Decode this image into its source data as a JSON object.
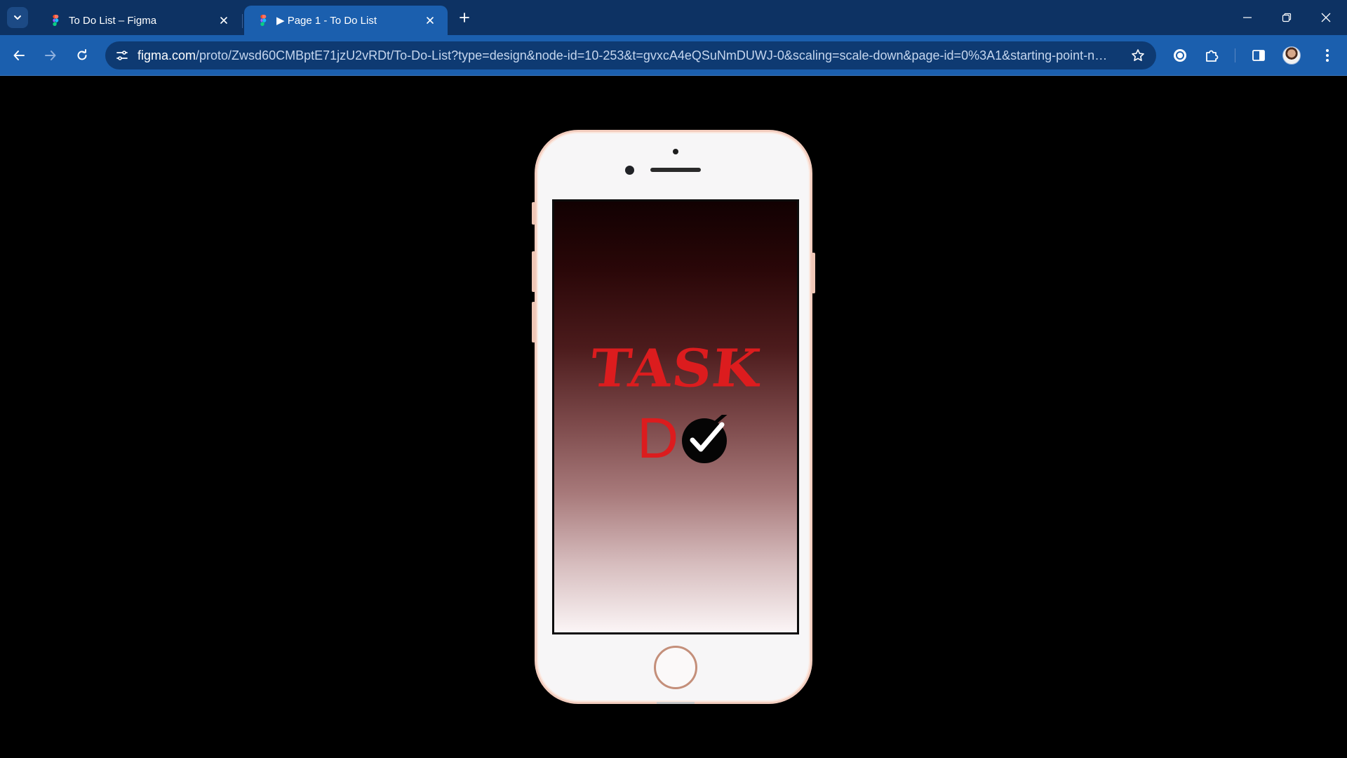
{
  "browser": {
    "tabs": [
      {
        "title": "To Do List – Figma",
        "active": false
      },
      {
        "title": "▶ Page 1 - To Do List",
        "active": true
      }
    ],
    "url_host": "figma.com",
    "url_path": "/proto/Zwsd60CMBptE71jzU2vRDt/To-Do-List?type=design&node-id=10-253&t=gvxcA4eQSuNmDUWJ-0&scaling=scale-down&page-id=0%3A1&starting-point-node-i...",
    "colors": {
      "tabstrip": "#0d3263",
      "toolbar": "#1b5fae",
      "omnibox": "#0e3a72"
    },
    "icons": {
      "tab_search": "chevron-down-icon",
      "favicon": "figma-icon",
      "close": "close-icon",
      "new_tab": "plus-icon",
      "back": "arrow-left-icon",
      "forward": "arrow-right-icon",
      "reload": "reload-icon",
      "site_info": "tune-icon",
      "bookmark": "star-icon",
      "extension_1": "extension-circle-icon",
      "extensions": "puzzle-icon",
      "side_panel": "side-panel-icon",
      "profile": "avatar",
      "menu": "more-vert-icon"
    }
  },
  "prototype": {
    "logo_line1": "TASK",
    "logo_line2": "D",
    "logo_color": "#dc1c1e",
    "screen_gradient": [
      "#120102",
      "#4c1b1c",
      "#a87a7b",
      "#fbf5f6"
    ]
  }
}
